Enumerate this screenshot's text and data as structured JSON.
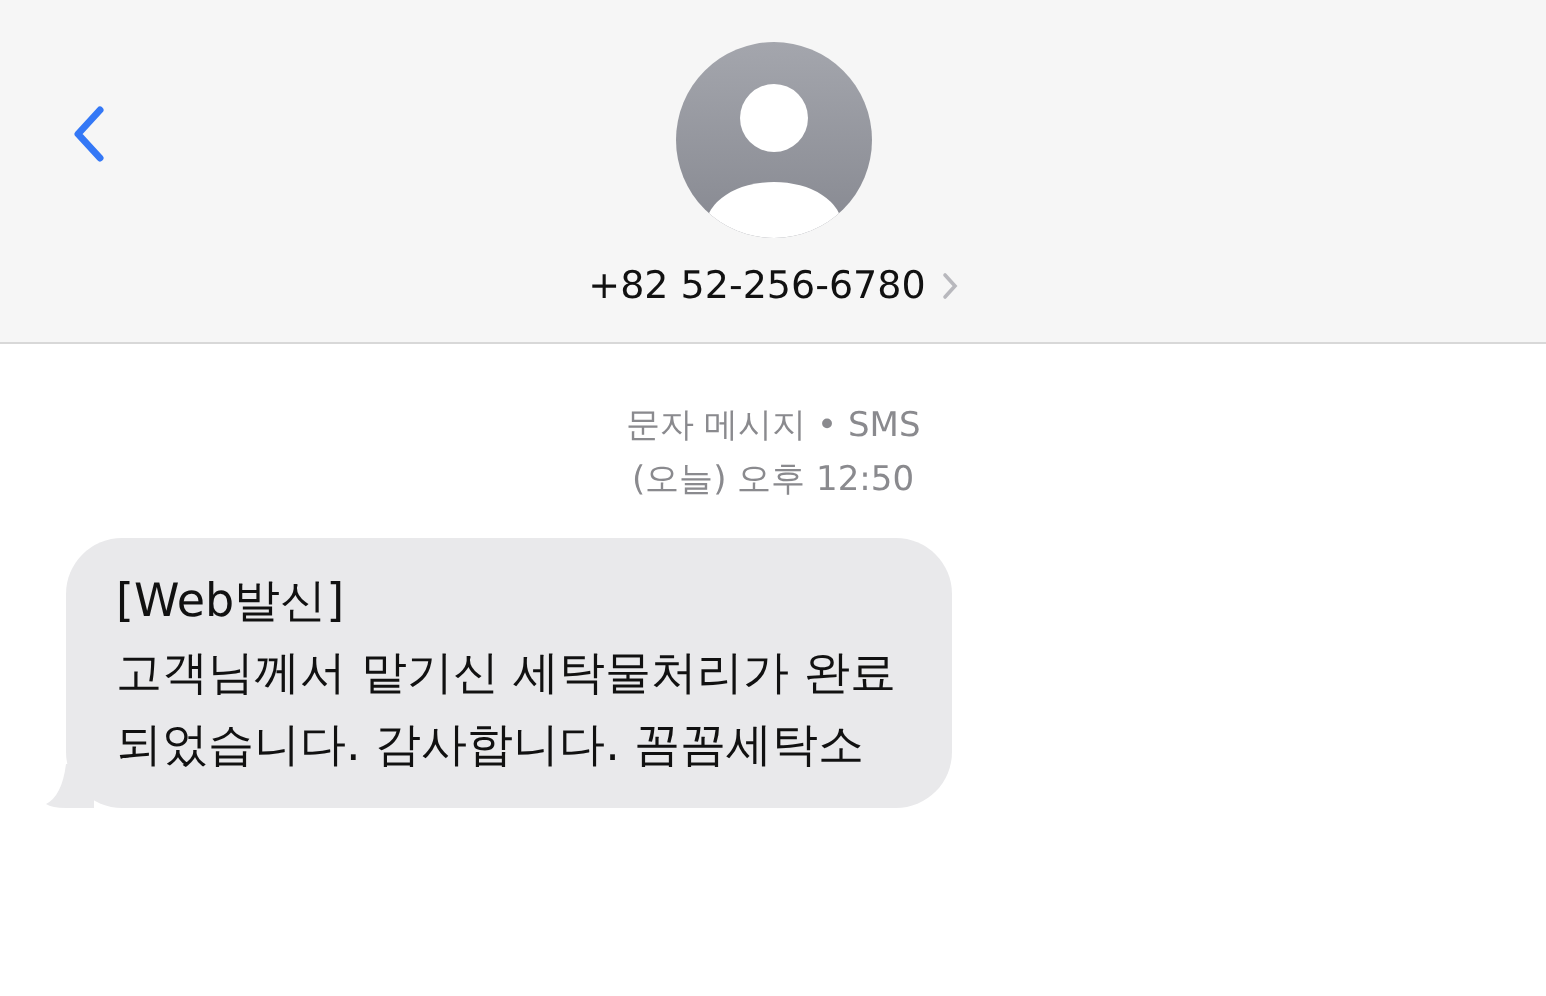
{
  "header": {
    "contact": "+82 52-256-6780"
  },
  "conversation": {
    "service": "문자 메시지 • SMS",
    "timestamp": "(오늘) 오후 12:50",
    "messages": [
      {
        "kind": "incoming",
        "text": "[Web발신]\n고객님께서 맡기신 세탁물처리가 완료\n되었습니다. 감사합니다. 꼼꼼세탁소"
      }
    ]
  }
}
